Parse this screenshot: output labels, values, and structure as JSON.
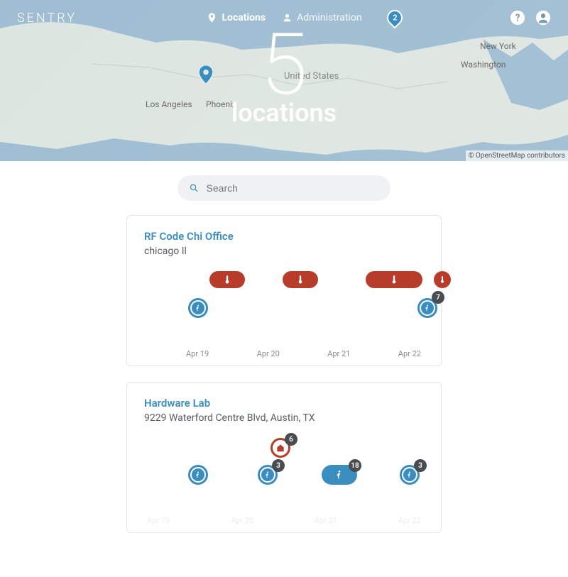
{
  "brand": "SENTRY",
  "nav": {
    "locations": "Locations",
    "administration": "Administration"
  },
  "hero": {
    "count": "5",
    "label": "locations",
    "country_label": "United States"
  },
  "map_labels": {
    "la": "Los Angeles",
    "phoenix": "Phoenix",
    "ny": "New York",
    "washington": "Washington"
  },
  "map_pins": {
    "cluster_badge": "2"
  },
  "attribution": "© OpenStreetMap contributors",
  "search": {
    "placeholder": "Search"
  },
  "locations": [
    {
      "name": "RF Code Chi Office",
      "address": "chicago Il",
      "dates": [
        "Apr 19",
        "Apr 20",
        "Apr 21",
        "Apr 22"
      ],
      "badges": {
        "motion_count": "7"
      }
    },
    {
      "name": "Hardware Lab",
      "address": "9229 Waterford Centre Blvd, Austin, TX",
      "dates": [
        "Apr 19",
        "Apr 20",
        "Apr 21",
        "Apr 22"
      ],
      "badges": {
        "door_count": "6",
        "motion1": "3",
        "motion2": "18",
        "motion3": "3"
      }
    }
  ],
  "colors": {
    "accent": "#3a8dbf",
    "alert": "#b73d2a",
    "dark": "#4a4d50"
  }
}
